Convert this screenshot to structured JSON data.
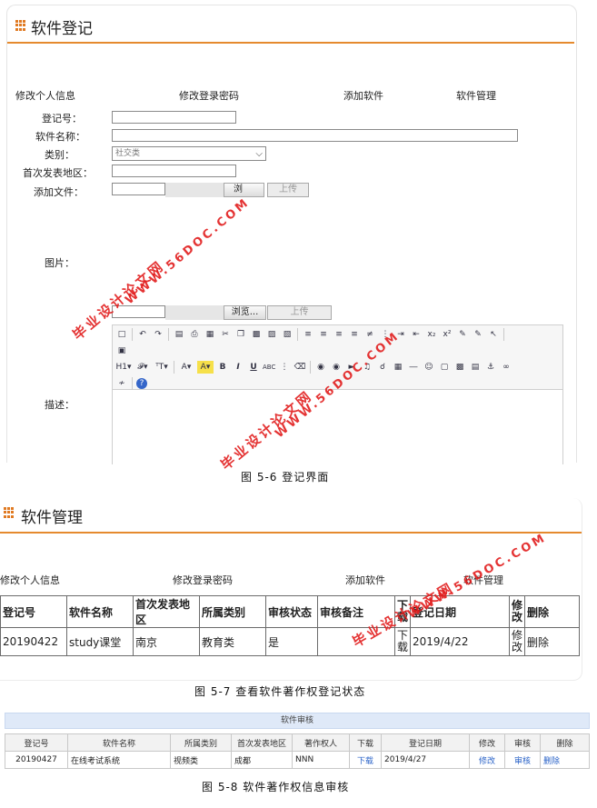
{
  "s1": {
    "title": "软件登记",
    "nav": [
      "修改个人信息",
      "修改登录密码",
      "添加软件",
      "软件管理"
    ],
    "labels": {
      "reg_no": "登记号：",
      "name": "软件名称：",
      "category": "类别：",
      "region": "首次发表地区：",
      "add_file": "添加文件：",
      "picture": "图片：",
      "desc": "描述："
    },
    "category_selected": "社交类",
    "browse_label": "浏览...",
    "browse_label_short": "浏",
    "upload_label": "上传",
    "toolbar_h1": "H1",
    "caption": "图 5-6 登记界面"
  },
  "s2": {
    "title": "软件管理",
    "nav": [
      "修改个人信息",
      "修改登录密码",
      "添加软件",
      "软件管理"
    ],
    "headers": [
      "登记号",
      "软件名称",
      "首次发表地区",
      "所属类别",
      "审核状态",
      "审核备注",
      "下载",
      "登记日期",
      "修改",
      "删除"
    ],
    "row": {
      "reg_no": "20190422",
      "name": "study课堂",
      "region": "南京",
      "category": "教育类",
      "status": "是",
      "remark": "",
      "download": "下载",
      "date": "2019/4/22",
      "edit": "修改",
      "delete": "删除"
    },
    "caption": "图 5-7 查看软件著作权登记状态"
  },
  "s3": {
    "bar_title": "软件审核",
    "headers": [
      "登记号",
      "软件名称",
      "所属类别",
      "首次发表地区",
      "著作权人",
      "下载",
      "登记日期",
      "修改",
      "审核",
      "删除"
    ],
    "row": {
      "reg_no": "20190427",
      "name": "在线考试系统",
      "category": "视频类",
      "region": "成都",
      "owner": "NNN",
      "download": "下载",
      "date": "2019/4/27",
      "edit": "修改",
      "audit": "审核",
      "delete": "删除"
    },
    "caption": "图 5-8 软件著作权信息审核"
  },
  "watermark": {
    "cn": "毕业设计论文网",
    "url": "WWW.56DOC.COM"
  },
  "colors": {
    "accent": "#e58a2e",
    "watermark": "#e21d1d",
    "link": "#2a63c8",
    "audit_bar": "#dfe9f8"
  }
}
